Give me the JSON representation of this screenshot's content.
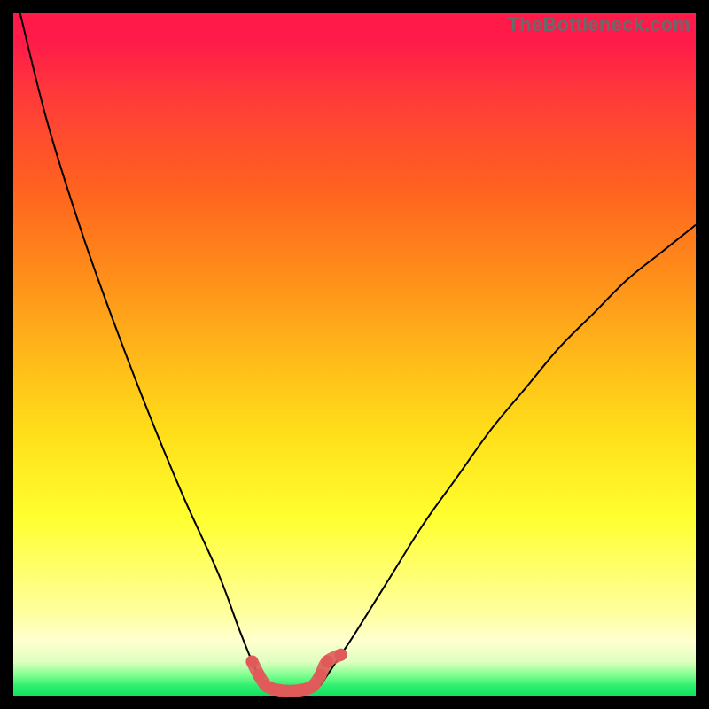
{
  "watermark": "TheBottleneck.com",
  "chart_data": {
    "type": "line",
    "title": "",
    "xlabel": "",
    "ylabel": "",
    "xlim": [
      0,
      100
    ],
    "ylim": [
      0,
      100
    ],
    "grid": false,
    "legend": false,
    "series": [
      {
        "name": "left-curve",
        "stroke": "#000000",
        "x": [
          1,
          5,
          10,
          15,
          20,
          25,
          30,
          33,
          35,
          36,
          37
        ],
        "values": [
          100,
          84,
          68,
          54,
          41,
          29,
          18,
          10,
          5,
          3,
          1.5
        ]
      },
      {
        "name": "right-curve",
        "stroke": "#000000",
        "x": [
          45,
          46,
          48,
          50,
          55,
          60,
          65,
          70,
          75,
          80,
          85,
          90,
          95,
          100
        ],
        "values": [
          1.5,
          3,
          6,
          9,
          17,
          25,
          32,
          39,
          45,
          51,
          56,
          61,
          65,
          69
        ]
      },
      {
        "name": "bottom-highlight",
        "stroke": "#e05a5a",
        "x": [
          35,
          36,
          37,
          38,
          39,
          40,
          41,
          42,
          43,
          44,
          45,
          46,
          48
        ],
        "values": [
          5,
          3,
          1.5,
          1,
          0.8,
          0.7,
          0.7,
          0.8,
          1,
          1.5,
          3,
          5,
          6
        ]
      }
    ],
    "background_gradient": {
      "top": "#ff1a4a",
      "upper_mid": "#ff8c1a",
      "mid": "#ffe01a",
      "lower_mid": "#ffffa0",
      "bottom": "#10e060"
    }
  }
}
